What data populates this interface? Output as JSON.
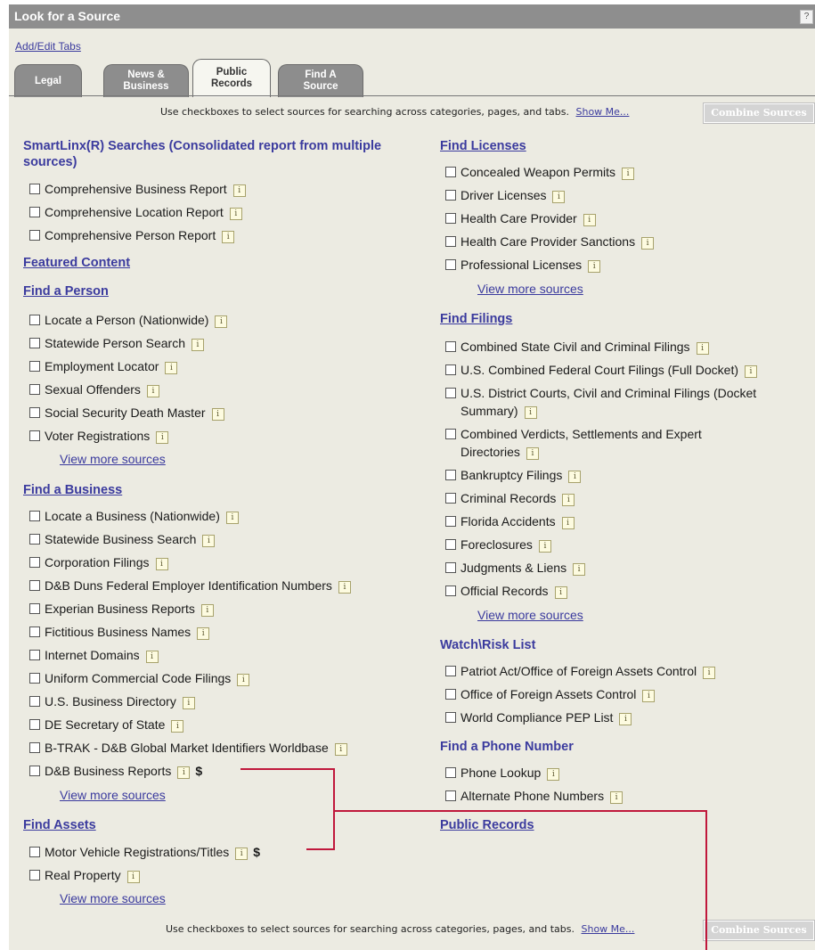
{
  "window": {
    "title": "Look for a Source",
    "help_glyph": "?"
  },
  "add_edit_tabs": "Add/Edit Tabs",
  "tabs": [
    {
      "label": "Legal"
    },
    {
      "label": "News &\nBusiness"
    },
    {
      "label": "Public\nRecords"
    },
    {
      "label": "Find A\nSource"
    }
  ],
  "tip": {
    "text": "Use checkboxes to select sources for searching across categories, pages, and tabs.",
    "show_me": "Show Me...",
    "combine": "Combine Sources"
  },
  "left": {
    "smartlinx": {
      "title": "SmartLinx(R) Searches (Consolidated report from multiple sources)",
      "items": [
        "Comprehensive Business Report",
        "Comprehensive Location Report",
        "Comprehensive Person Report"
      ]
    },
    "featured": "Featured Content",
    "person": {
      "title": "Find a Person",
      "items": [
        "Locate a Person (Nationwide)",
        "Statewide Person Search",
        "Employment Locator",
        "Sexual Offenders",
        "Social Security Death Master",
        "Voter Registrations"
      ],
      "more": "View more sources"
    },
    "business": {
      "title": "Find a Business",
      "items": [
        "Locate a Business (Nationwide)",
        "Statewide Business Search",
        "Corporation Filings",
        "D&B Duns Federal Employer Identification Numbers",
        "Experian Business Reports",
        "Fictitious Business Names",
        "Internet Domains",
        "Uniform Commercial Code Filings",
        "U.S. Business Directory",
        "DE Secretary of State",
        "B-TRAK - D&B Global Market Identifiers Worldbase",
        "D&B Business Reports"
      ],
      "more": "View more sources"
    },
    "assets": {
      "title": "Find Assets",
      "items": [
        "Motor Vehicle Registrations/Titles",
        "Real Property"
      ],
      "more": "View more sources"
    },
    "dollar": "$"
  },
  "right": {
    "licenses": {
      "title": "Find Licenses",
      "items": [
        "Concealed Weapon Permits",
        "Driver Licenses",
        "Health Care Provider",
        "Health Care Provider Sanctions",
        "Professional Licenses"
      ],
      "more": "View more sources"
    },
    "filings": {
      "title": "Find Filings",
      "items": [
        "Combined State Civil and Criminal Filings",
        "U.S. Combined Federal Court Filings (Full Docket)",
        "U.S. District Courts, Civil and Criminal Filings (Docket",
        "Summary)",
        "Combined Verdicts, Settlements and Expert",
        "Directories",
        "Bankruptcy Filings",
        "Criminal Records",
        "Florida Accidents",
        "Foreclosures",
        "Judgments & Liens",
        "Official Records"
      ],
      "more": "View more sources"
    },
    "watch": {
      "title": "Watch\\Risk List",
      "items": [
        "Patriot Act/Office of Foreign Assets Control",
        "Office of Foreign Assets Control",
        "World Compliance PEP List"
      ]
    },
    "phone": {
      "title": "Find a Phone Number",
      "items": [
        "Phone Lookup",
        "Alternate Phone Numbers"
      ]
    },
    "public_records": "Public Records"
  },
  "colors": {
    "accent": "#3b3b9e",
    "titlebar": "#8e8e8e",
    "panel": "#ecebe2",
    "callout": "#c0183c"
  }
}
